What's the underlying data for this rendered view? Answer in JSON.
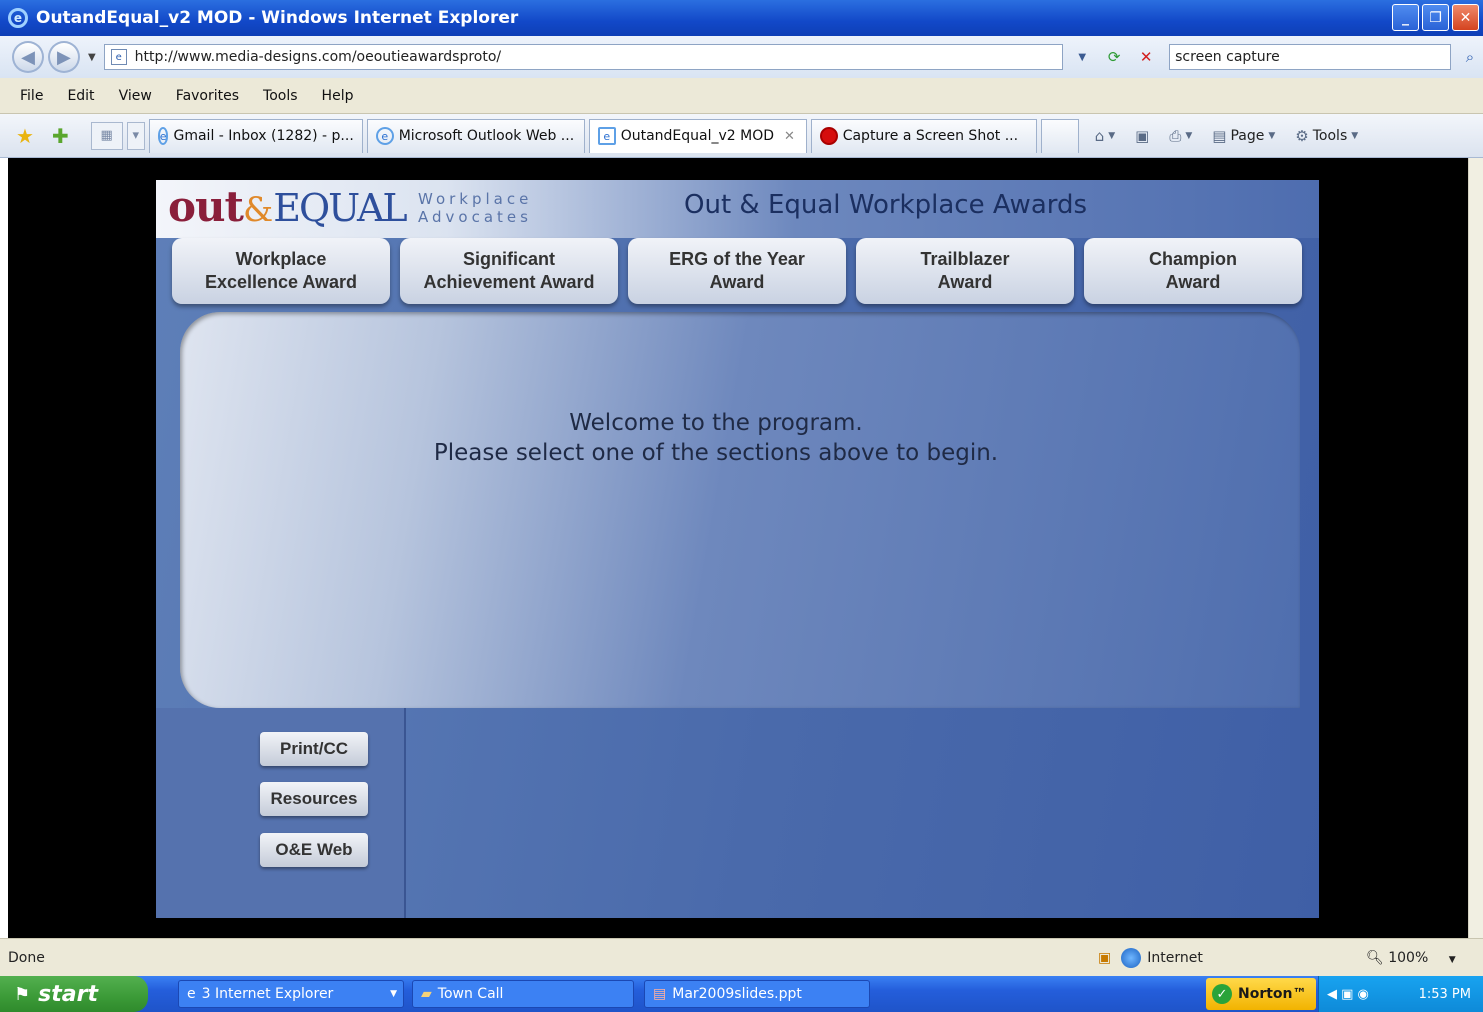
{
  "window": {
    "title": "OutandEqual_v2 MOD - Windows Internet Explorer",
    "controls": [
      "_",
      "❐",
      "✕"
    ]
  },
  "address_bar": {
    "url": "http://www.media-designs.com/oeoutieawardsproto/",
    "search_value": "screen capture"
  },
  "menu": [
    "File",
    "Edit",
    "View",
    "Favorites",
    "Tools",
    "Help"
  ],
  "tabs": [
    {
      "label": "Gmail - Inbox (1282) - p...",
      "icon": "ie-icon"
    },
    {
      "label": "Microsoft Outlook Web ...",
      "icon": "ie-icon"
    },
    {
      "label": "OutandEqual_v2 MOD",
      "icon": "page-icon",
      "active": true
    },
    {
      "label": "Capture a Screen Shot ...",
      "icon": "red-dot-icon"
    }
  ],
  "command_bar": {
    "page_label": "Page",
    "tools_label": "Tools"
  },
  "app": {
    "logo_out": "out",
    "logo_amp": "&",
    "logo_equal": "EQUAL",
    "logo_sub_line1": "Workplace",
    "logo_sub_line2": "Advocates",
    "title": "Out & Equal Workplace Awards",
    "awards": [
      "Workplace\nExcellence Award",
      "Significant\nAchievement Award",
      "ERG of the Year\nAward",
      "Trailblazer\nAward",
      "Champion\nAward"
    ],
    "welcome_line1": "Welcome to the program.",
    "welcome_line2": "Please select one of the sections above to begin.",
    "side_buttons": [
      "Print/CC",
      "Resources",
      "O&E Web"
    ]
  },
  "status": {
    "text": "Done",
    "zone": "Internet",
    "zoom": "100%"
  },
  "taskbar": {
    "start": "start",
    "tasks": [
      "3 Internet Explorer",
      "Town Call",
      "Mar2009slides.ppt"
    ],
    "norton": "Norton™",
    "clock": "1:53 PM"
  },
  "colors": {
    "title_bar": "#1248c8",
    "app_background": "#4a6aab",
    "logo_out": "#8a1f3b",
    "logo_equal": "#2e4f9c",
    "taskbar": "#245edb",
    "start_button": "#3b9a37"
  }
}
